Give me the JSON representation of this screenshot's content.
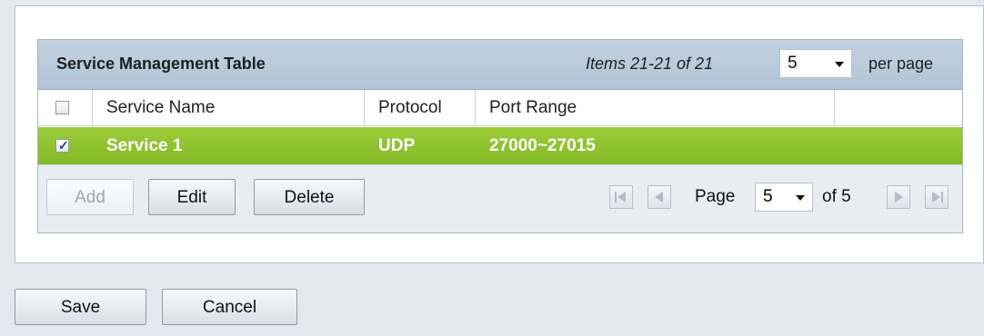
{
  "table": {
    "title": "Service Management Table",
    "items_text": "Items 21-21 of 21",
    "per_page_value": "5",
    "per_page_label": "per page",
    "columns": [
      "Service Name",
      "Protocol",
      "Port Range"
    ],
    "rows": [
      {
        "checked": true,
        "service_name": "Service 1",
        "protocol": "UDP",
        "port_range": "27000~27015"
      }
    ],
    "row_highlight_color": "#8fc32f",
    "actions": {
      "add": "Add",
      "edit": "Edit",
      "delete": "Delete"
    },
    "pagination": {
      "page_label": "Page",
      "current_page": "5",
      "of_text": "of 5"
    }
  },
  "form_buttons": {
    "save": "Save",
    "cancel": "Cancel"
  }
}
